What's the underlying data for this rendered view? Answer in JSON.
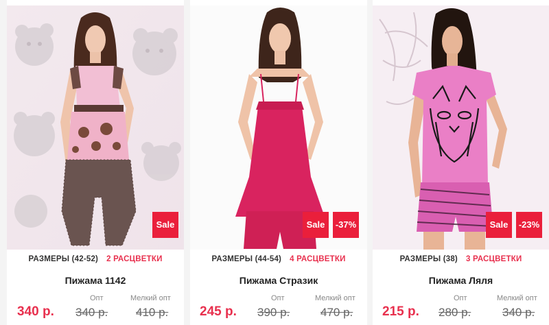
{
  "products": [
    {
      "name": "Пижама 1142",
      "sizes_label": "РАЗМЕРЫ (42-52)",
      "colors_label": "2 РАСЦВЕТКИ",
      "price": "340 р.",
      "opt_label": "Опт",
      "opt_price": "340 р.",
      "small_opt_label": "Мелкий опт",
      "small_opt_price": "410 р.",
      "badges": {
        "sale": "Sale",
        "discount": ""
      }
    },
    {
      "name": "Пижама Стразик",
      "sizes_label": "РАЗМЕРЫ (44-54)",
      "colors_label": "4 РАСЦВЕТКИ",
      "price": "245 р.",
      "opt_label": "Опт",
      "opt_price": "390 р.",
      "small_opt_label": "Мелкий опт",
      "small_opt_price": "470 р.",
      "badges": {
        "sale": "Sale",
        "discount": "-37%"
      }
    },
    {
      "name": "Пижама Ляля",
      "sizes_label": "РАЗМЕРЫ (38)",
      "colors_label": "3 РАСЦВЕТКИ",
      "price": "215 р.",
      "opt_label": "Опт",
      "opt_price": "280 р.",
      "small_opt_label": "Мелкий опт",
      "small_opt_price": "340 р.",
      "badges": {
        "sale": "Sale",
        "discount": "-23%"
      }
    }
  ],
  "colors": {
    "accent": "#e8304e",
    "badge": "#ea1f3b",
    "card_bg": "#ffffff",
    "page_bg": "#f4f4f4"
  }
}
